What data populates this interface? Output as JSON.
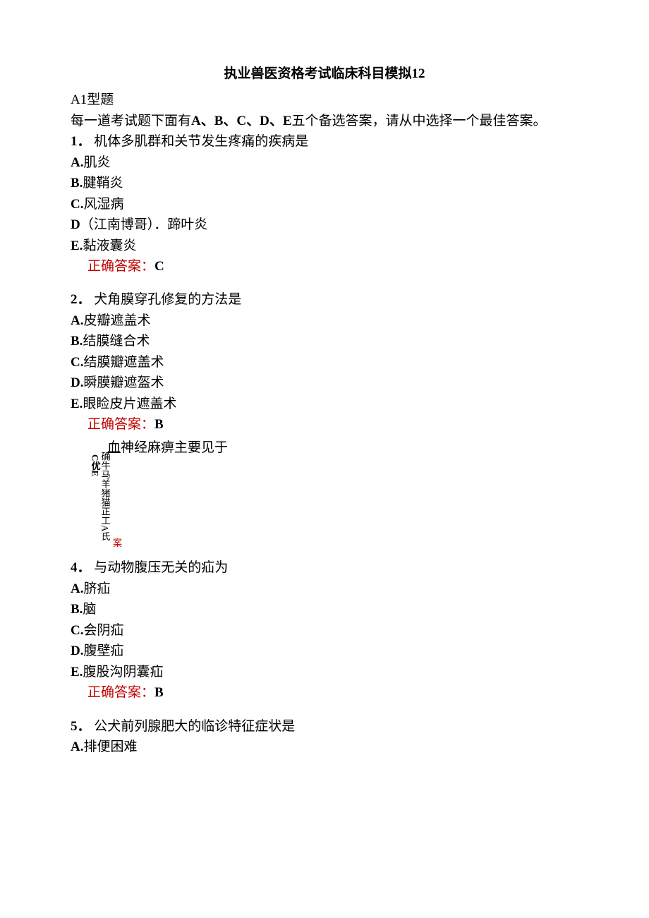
{
  "title": "执业兽医资格考试临床科目模拟12",
  "sectionHeading": "A1型题",
  "instructions_a": "每一道考试题下面有",
  "instructions_b": "A、B、C、D、E",
  "instructions_c": "五个备选答案，请从中选择一个最佳答案。",
  "q1": {
    "num": "1．",
    "stem": "机体多肌群和关节发生疼痛的疾病是",
    "optA_label": "A.",
    "optA_text": "肌炎",
    "optB_label": "B.",
    "optB_text": "腱鞘炎",
    "optC_label": "C.",
    "optC_text": "风湿病",
    "optD_label": "D",
    "optD_paren": "（江南博哥）．",
    "optD_text": "蹄叶炎",
    "optE_label": "E.",
    "optE_text": "黏液囊炎",
    "answer_label": "正确答案：",
    "answer_value": "C"
  },
  "q2": {
    "num": "2．",
    "stem": "犬角膜穿孔修复的方法是",
    "optA_label": "A.",
    "optA_text": "皮瓣遮盖术",
    "optB_label": "B.",
    "optB_text": "结膜缝合术",
    "optC_label": "C.",
    "optC_text": "结膜瓣遮盖术",
    "optD_label": "D.",
    "optD_text": "瞬膜瓣遮盔术",
    "optE_label": "E.",
    "optE_text": "眼睑皮片遮盖术",
    "answer_label": "正确答案：",
    "answer_value": "B"
  },
  "q3": {
    "horizontal_pre": "血",
    "horizontal_rest": "神经麻痹主要见于",
    "vertical": "确牛马羊猪猫正工A氏",
    "side": "C优E",
    "ans": "案"
  },
  "q4": {
    "num": "4．",
    "stem": "与动物腹压无关的疝为",
    "optA_label": "A.",
    "optA_text": "脐疝",
    "optB_label": "B.",
    "optB_text": "脑",
    "optC_label": "C.",
    "optC_text": "会阴疝",
    "optD_label": "D.",
    "optD_text": "腹壁疝",
    "optE_label": "E.",
    "optE_text": "腹股沟阴囊疝",
    "answer_label": "正确答案：",
    "answer_value": "B"
  },
  "q5": {
    "num": "5．",
    "stem": "公犬前列腺肥大的临诊特征症状是",
    "optA_label": "A.",
    "optA_text": "排便困难"
  }
}
